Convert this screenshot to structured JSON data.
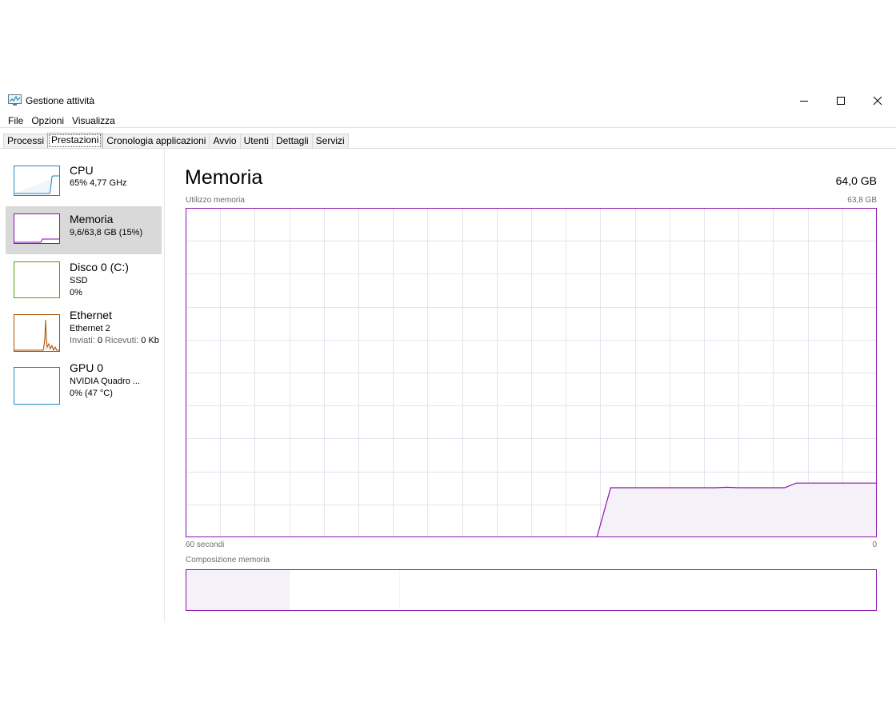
{
  "window": {
    "title": "Gestione attività",
    "app_icon": "task-manager-icon"
  },
  "menu": [
    "File",
    "Opzioni",
    "Visualizza"
  ],
  "tabs": [
    {
      "label": "Processi",
      "active": false
    },
    {
      "label": "Prestazioni",
      "active": true
    },
    {
      "label": "Cronologia applicazioni",
      "active": false
    },
    {
      "label": "Avvio",
      "active": false
    },
    {
      "label": "Utenti",
      "active": false
    },
    {
      "label": "Dettagli",
      "active": false
    },
    {
      "label": "Servizi",
      "active": false
    }
  ],
  "sidebar": {
    "items": [
      {
        "name": "CPU",
        "line1": "65%  4,77 GHz",
        "color": "#1f86c1"
      },
      {
        "name": "Memoria",
        "line1": "9,6/63,8 GB (15%)",
        "color": "#8b12ae",
        "selected": true
      },
      {
        "name": "Disco 0 (C:)",
        "line1": "SSD",
        "line2": "0%",
        "color": "#4da60c"
      },
      {
        "name": "Ethernet",
        "line1": "Ethernet 2",
        "line2_sent_label": "Inviati:",
        "line2_sent_value": "0",
        "line2_recv_label": "Ricevuti:",
        "line2_recv_value": "0 Kb",
        "color": "#a74f01"
      },
      {
        "name": "GPU 0",
        "line1": "NVIDIA Quadro ...",
        "line2": "0%  (47 °C)",
        "color": "#1f86c1"
      }
    ]
  },
  "main": {
    "title": "Memoria",
    "capacity": "64,0 GB",
    "usage_label": "Utilizzo memoria",
    "usage_max": "63,8 GB",
    "x_left": "60 secondi",
    "x_right": "0",
    "composition_label": "Composizione memoria",
    "accent_color": "#8b12ae",
    "fill_color": "#f4f2f8",
    "grid_color": "#e8e2ee"
  },
  "chart_data": {
    "type": "area",
    "title": "",
    "xlabel": "",
    "ylabel": "",
    "xlim": [
      60,
      0
    ],
    "ylim": [
      0,
      63.8
    ],
    "grid": true,
    "x": [
      60,
      24.3,
      23.1,
      18,
      14,
      13,
      12,
      8,
      7,
      0
    ],
    "series": [
      {
        "values": [
          0,
          0,
          9.6,
          9.6,
          9.6,
          9.7,
          9.6,
          9.6,
          10.5,
          10.5
        ]
      }
    ],
    "composition": {
      "segments": [
        {
          "fraction": 0.15,
          "filled": true
        },
        {
          "fraction": 0.16,
          "filled": false
        },
        {
          "fraction": 0.69,
          "filled": false
        }
      ]
    }
  }
}
